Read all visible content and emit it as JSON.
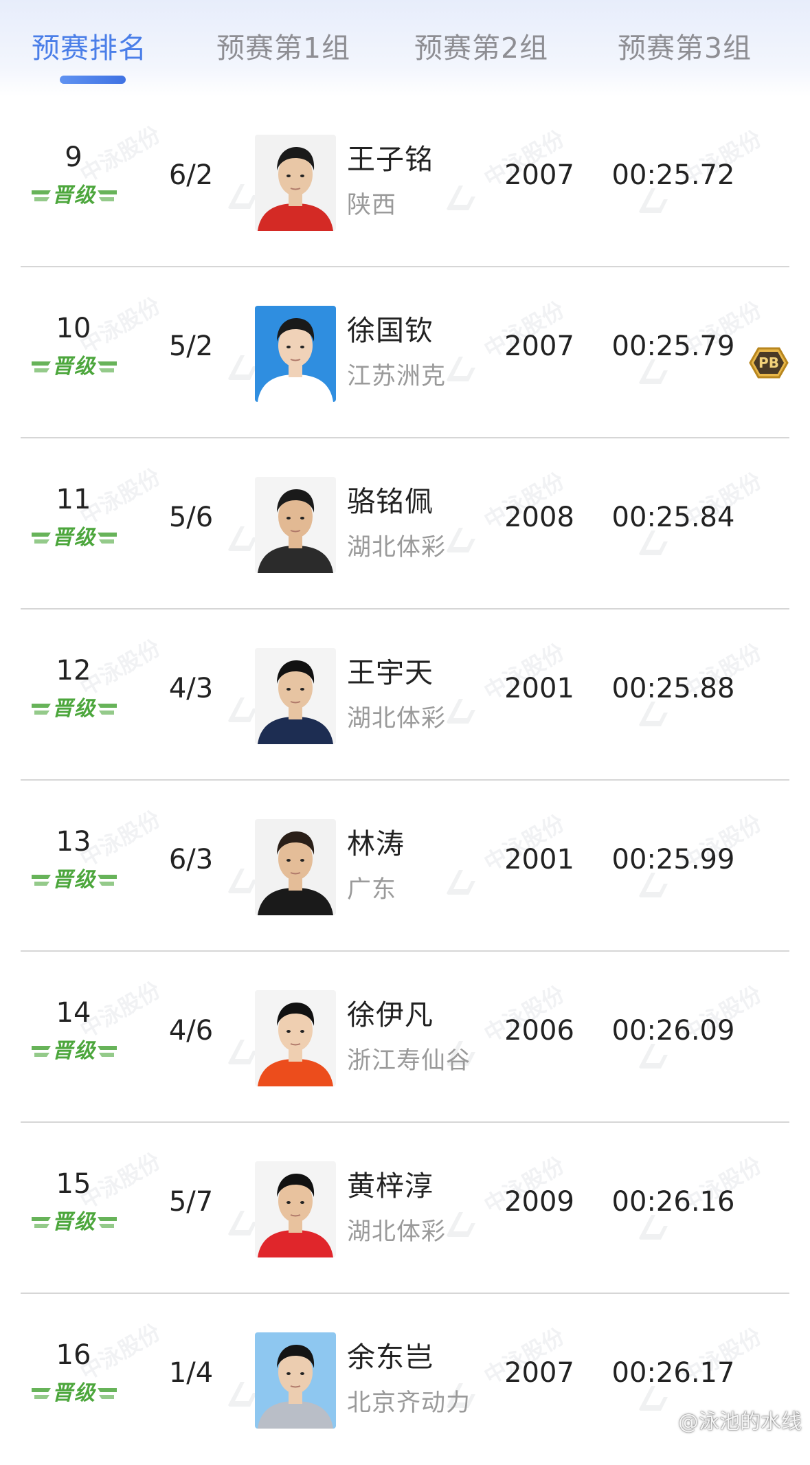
{
  "tabs": [
    {
      "label": "预赛排名",
      "active": true
    },
    {
      "label": "预赛第1组",
      "active": false
    },
    {
      "label": "预赛第2组",
      "active": false
    },
    {
      "label": "预赛第3组",
      "active": false
    }
  ],
  "colors": {
    "accent": "#4a7ee8",
    "qualified_green": "#4ca63c",
    "divider": "#d6d6d6",
    "pb_gold": "#d9a63a"
  },
  "qualified_label": "晋级",
  "pb_label": "PB",
  "watermark_text": "中泳股份",
  "results": [
    {
      "rank": "9",
      "lane": "6/2",
      "name": "王子铭",
      "team": "陕西",
      "year": "2007",
      "time": "00:25.72",
      "pb": false
    },
    {
      "rank": "10",
      "lane": "5/2",
      "name": "徐国钦",
      "team": "江苏洲克",
      "year": "2007",
      "time": "00:25.79",
      "pb": true
    },
    {
      "rank": "11",
      "lane": "5/6",
      "name": "骆铭佩",
      "team": "湖北体彩",
      "year": "2008",
      "time": "00:25.84",
      "pb": false
    },
    {
      "rank": "12",
      "lane": "4/3",
      "name": "王宇天",
      "team": "湖北体彩",
      "year": "2001",
      "time": "00:25.88",
      "pb": false
    },
    {
      "rank": "13",
      "lane": "6/3",
      "name": "林涛",
      "team": "广东",
      "year": "2001",
      "time": "00:25.99",
      "pb": false
    },
    {
      "rank": "14",
      "lane": "4/6",
      "name": "徐伊凡",
      "team": "浙江寿仙谷",
      "year": "2006",
      "time": "00:26.09",
      "pb": false
    },
    {
      "rank": "15",
      "lane": "5/7",
      "name": "黄梓淳",
      "team": "湖北体彩",
      "year": "2009",
      "time": "00:26.16",
      "pb": false
    },
    {
      "rank": "16",
      "lane": "1/4",
      "name": "余东岂",
      "team": "北京齐动力",
      "year": "2007",
      "time": "00:26.17",
      "pb": false
    }
  ],
  "credit": "@泳池的水线"
}
